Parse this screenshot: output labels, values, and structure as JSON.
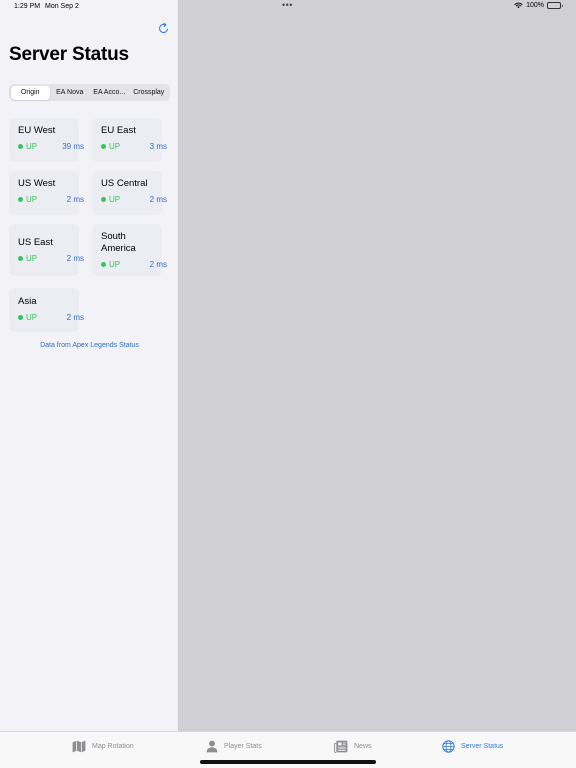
{
  "status_bar": {
    "time": "1:29 PM",
    "date": "Mon Sep 2",
    "dots": "•••",
    "battery": "100%"
  },
  "page": {
    "title": "Server Status"
  },
  "segments": [
    "Origin",
    "EA Nova",
    "EA Acco...",
    "Crossplay"
  ],
  "servers": [
    {
      "name": "EU West",
      "status": "UP",
      "latency": "39 ms"
    },
    {
      "name": "EU East",
      "status": "UP",
      "latency": "3 ms"
    },
    {
      "name": "US West",
      "status": "UP",
      "latency": "2 ms"
    },
    {
      "name": "US Central",
      "status": "UP",
      "latency": "2 ms"
    },
    {
      "name": "US East",
      "status": "UP",
      "latency": "2 ms"
    },
    {
      "name": "South America",
      "status": "UP",
      "latency": "2 ms"
    },
    {
      "name": "Asia",
      "status": "UP",
      "latency": "2 ms"
    }
  ],
  "footer": {
    "link": "Data from Apex Legends Status"
  },
  "tabs": [
    {
      "label": "Map Rotation",
      "icon": "map-icon"
    },
    {
      "label": "Player Stats",
      "icon": "person-icon"
    },
    {
      "label": "News",
      "icon": "newspaper-icon"
    },
    {
      "label": "Server Status",
      "icon": "globe-icon"
    }
  ],
  "colors": {
    "accent": "#2f7de1",
    "status_up": "#34c759",
    "latency": "#2f6fc4"
  }
}
